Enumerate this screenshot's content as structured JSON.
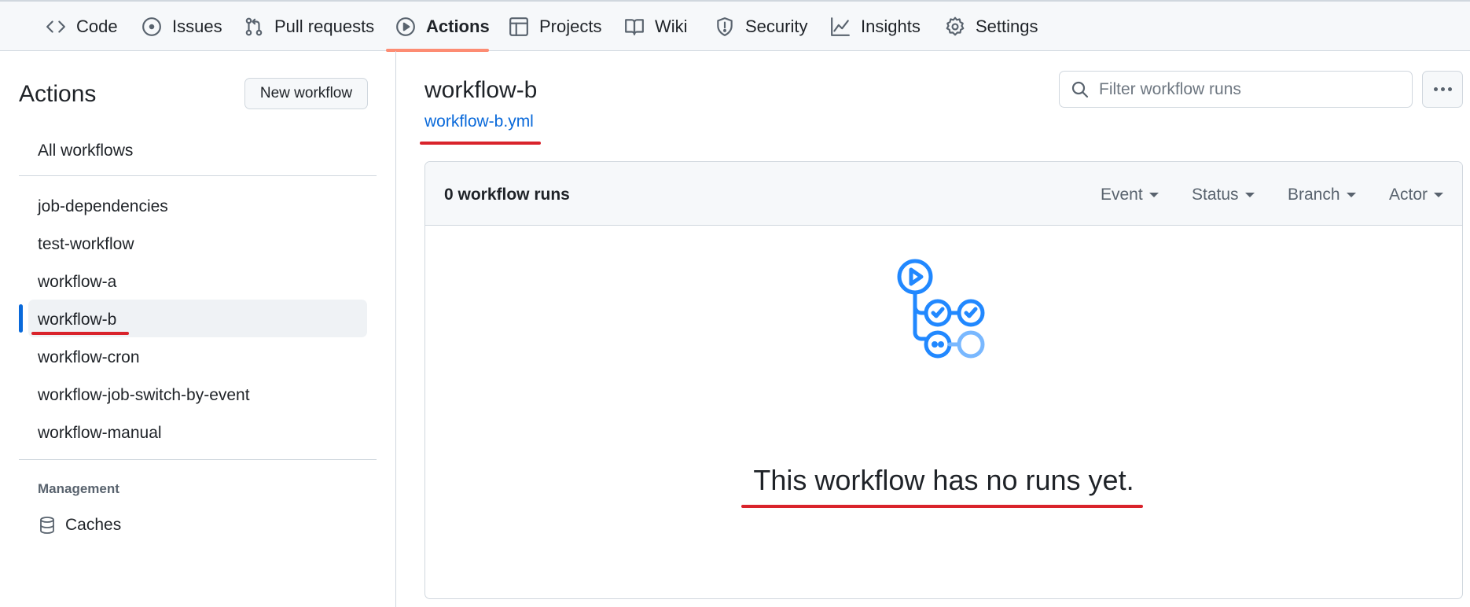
{
  "tabs": [
    {
      "label": "Code",
      "icon": "code-icon"
    },
    {
      "label": "Issues",
      "icon": "issue-opened-icon"
    },
    {
      "label": "Pull requests",
      "icon": "git-pull-request-icon"
    },
    {
      "label": "Actions",
      "icon": "play-icon",
      "active": true
    },
    {
      "label": "Projects",
      "icon": "table-icon"
    },
    {
      "label": "Wiki",
      "icon": "book-icon"
    },
    {
      "label": "Security",
      "icon": "shield-icon"
    },
    {
      "label": "Insights",
      "icon": "graph-icon"
    },
    {
      "label": "Settings",
      "icon": "gear-icon"
    }
  ],
  "sidebar": {
    "title": "Actions",
    "new_workflow_label": "New workflow",
    "all_workflows_label": "All workflows",
    "workflows": [
      {
        "label": "job-dependencies"
      },
      {
        "label": "test-workflow"
      },
      {
        "label": "workflow-a"
      },
      {
        "label": "workflow-b",
        "selected": true
      },
      {
        "label": "workflow-cron"
      },
      {
        "label": "workflow-job-switch-by-event"
      },
      {
        "label": "workflow-manual"
      }
    ],
    "management_heading": "Management",
    "caches_label": "Caches"
  },
  "main": {
    "workflow_title": "workflow-b",
    "workflow_file": "workflow-b.yml",
    "filter_placeholder": "Filter workflow runs",
    "runs_count": "0 workflow runs",
    "filters": [
      {
        "label": "Event"
      },
      {
        "label": "Status"
      },
      {
        "label": "Branch"
      },
      {
        "label": "Actor"
      }
    ],
    "empty_message": "This workflow has no runs yet."
  },
  "colors": {
    "accent": "#0969da",
    "active_tab_underline": "#fd8c73",
    "annotation": "#d9232b",
    "empty_icon": "#2188ff"
  }
}
